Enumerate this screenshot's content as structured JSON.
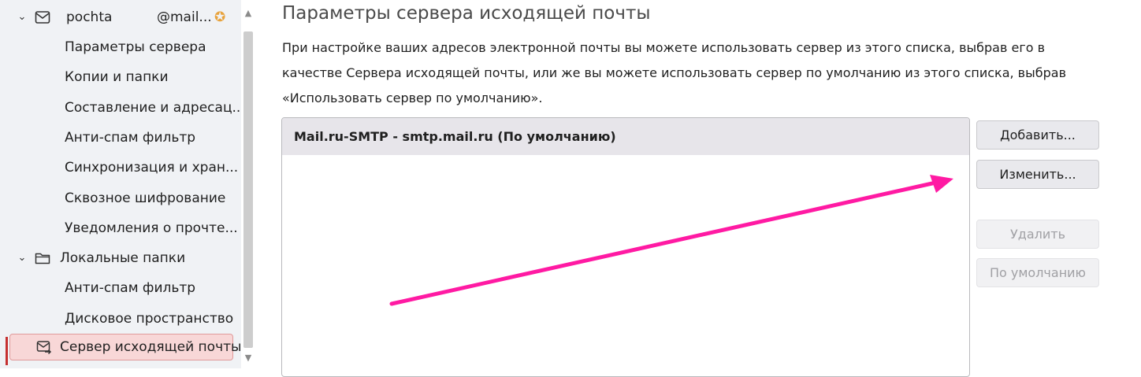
{
  "sidebar": {
    "account": {
      "name": "pochta",
      "email": "@mail...",
      "icon": "mail-account-icon"
    },
    "account_children": [
      "Параметры сервера",
      "Копии и папки",
      "Составление и адресац...",
      "Анти-спам фильтр",
      "Синхронизация и хран...",
      "Сквозное шифрование",
      "Уведомления о прочте..."
    ],
    "local": {
      "name": "Локальные папки",
      "icon": "folder-icon"
    },
    "local_children": [
      "Анти-спам фильтр",
      "Дисковое пространство"
    ],
    "selected": {
      "label": "Сервер исходящей почты",
      "icon": "outgoing-server-icon"
    }
  },
  "main": {
    "title": "Параметры сервера исходящей почты",
    "description": "При настройке ваших адресов электронной почты вы можете использовать сервер из этого списка, выбрав его в качестве Сервера исходящей почты, или же вы можете использовать сервер по умолчанию из этого списка, выбрав «Использовать сервер по умолчанию».",
    "servers": [
      "Mail.ru-SMTP - smtp.mail.ru (По умолчанию)"
    ],
    "buttons": {
      "add": "Добавить...",
      "edit": "Изменить...",
      "delete": "Удалить",
      "set_default": "По умолчанию"
    }
  },
  "colors": {
    "annotation_arrow": "#ff1aa3",
    "selected_bg": "#f8d7d7",
    "accent_red": "#c53030"
  }
}
